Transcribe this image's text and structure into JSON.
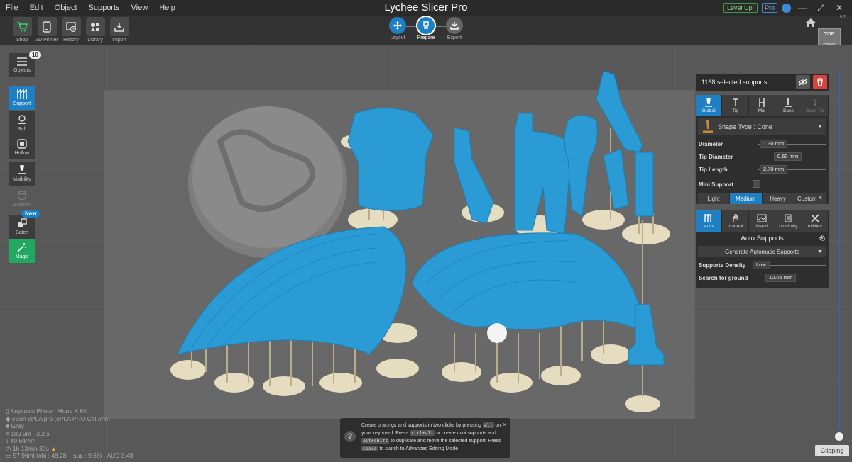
{
  "menu": {
    "items": [
      "File",
      "Edit",
      "Object",
      "Supports",
      "View",
      "Help"
    ],
    "title": "Lychee Slicer Pro",
    "level_up": "Level Up!",
    "pro": "Pro"
  },
  "toolbar": {
    "shop": "Shop",
    "printer": "3D Printer",
    "history": "History",
    "library": "Library",
    "import": "Import"
  },
  "steps": {
    "layout": "Layout",
    "prepare": "Prepare",
    "export": "Export"
  },
  "version": "5.7.1",
  "viewcube": {
    "top": "TOP",
    "front": "FRONT"
  },
  "sidebar": {
    "objects": "Objects",
    "objects_count": "10",
    "support": "Support",
    "raft": "Raft",
    "hollow": "Hollow",
    "visibility": "Visibility",
    "exterior": "Exterior",
    "batch": "Batch",
    "new_badge": "New",
    "magic": "Magic"
  },
  "supports_panel": {
    "selected": "1168 selected supports",
    "tabs": [
      "Global",
      "Tip",
      "Mid",
      "Base",
      "Base Tip"
    ],
    "shape_type": "Shape Type : Cone",
    "diameter_label": "Diameter",
    "diameter_value": "1.30 mm",
    "tip_diameter_label": "Tip Diameter",
    "tip_diameter_value": "0.60 mm",
    "tip_length_label": "Tip Length",
    "tip_length_value": "2.70 mm",
    "mini_support": "Mini Support",
    "density": [
      "Light",
      "Medium",
      "Heavy",
      "Custom"
    ]
  },
  "auto_panel": {
    "tabs": [
      "auto",
      "manual",
      "island",
      "proximity",
      "utilities"
    ],
    "header": "Auto Supports",
    "generate": "Generate Automatic Supports",
    "density_label": "Supports Density",
    "density_value": "Low",
    "search_label": "Search for ground",
    "search_value": "10.05 mm"
  },
  "info": {
    "printer": "Anycubic Photon Mono X 6K",
    "resin": "eSun ePLA pro (ePLA PRO Column)",
    "color": "Grey",
    "layer": "100 um - 3.2 s",
    "height": "40.64mm",
    "time": "1h 13min 39s",
    "volume": "57.96ml (obj : 48.28 + sup : 9.68) - AUD 3.48"
  },
  "tip": {
    "l1a": "Create bracings and supports in two clicks by pressing",
    "k1": "alt",
    "l2a": "on your keyboard. Press",
    "k2": "ctrl+alt",
    "l2b": "to create mini supports",
    "l3a": "and",
    "k3": "alt+shift",
    "l3b": "to duplicate and move the selected support.",
    "l4a": "Press",
    "k4": "space",
    "l4b": "to switch to Advanced Editing Mode"
  },
  "clipping": "Clipping",
  "colors": {
    "accent": "#1e7fc2",
    "model": "#2a9bd4",
    "raft": "#e6dcc0",
    "danger": "#d9443a"
  }
}
